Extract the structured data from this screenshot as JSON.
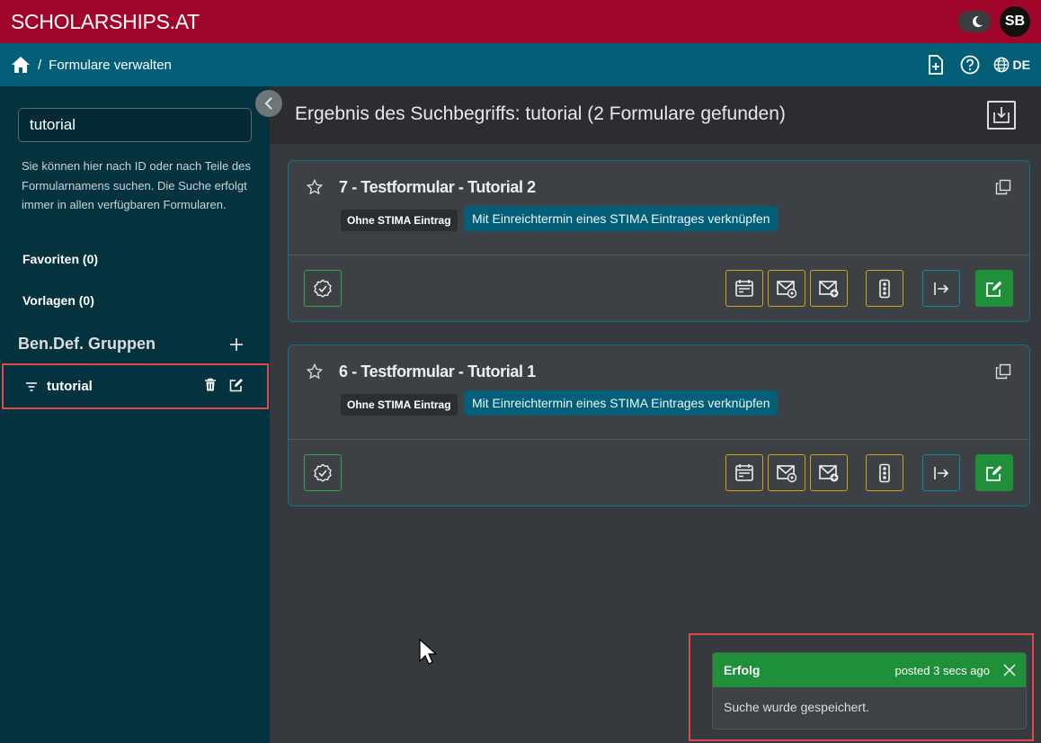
{
  "app": {
    "brand": "SCHOLARSHIPS.AT",
    "user_initials": "SB"
  },
  "nav": {
    "separator": "/",
    "breadcrumb": "Formulare verwalten",
    "language": "DE"
  },
  "sidebar": {
    "search_value": "tutorial",
    "hint": "Sie können hier nach ID oder nach Teile des Formularnamens suchen. Die Suche erfolgt immer in allen verfügbaren Formularen.",
    "favorites_label": "Favoriten (0)",
    "templates_label": "Vorlagen (0)",
    "groups_title": "Ben.Def. Gruppen",
    "groups": [
      {
        "label": "tutorial"
      }
    ]
  },
  "main": {
    "result_title": "Ergebnis des Suchbegriffs: tutorial (2 Formulare gefunden)",
    "forms": [
      {
        "title": "7 - Testformular - Tutorial 2",
        "badge": "Ohne STIMA Eintrag",
        "link_badge": "Mit Einreichtermin eines STIMA Eintrages verknüpfen"
      },
      {
        "title": "6 - Testformular - Tutorial 1",
        "badge": "Ohne STIMA Eintrag",
        "link_badge": "Mit Einreichtermin eines STIMA Eintrages verknüpfen"
      }
    ]
  },
  "toast": {
    "title": "Erfolg",
    "time": "posted 3 secs ago",
    "message": "Suche wurde gespeichert."
  },
  "colors": {
    "topbar": "#a0062a",
    "navbar": "#035e78",
    "sidebar": "#04323f",
    "success": "#1f8f3a",
    "warning": "#d4a017",
    "highlight": "#e24a4a"
  }
}
